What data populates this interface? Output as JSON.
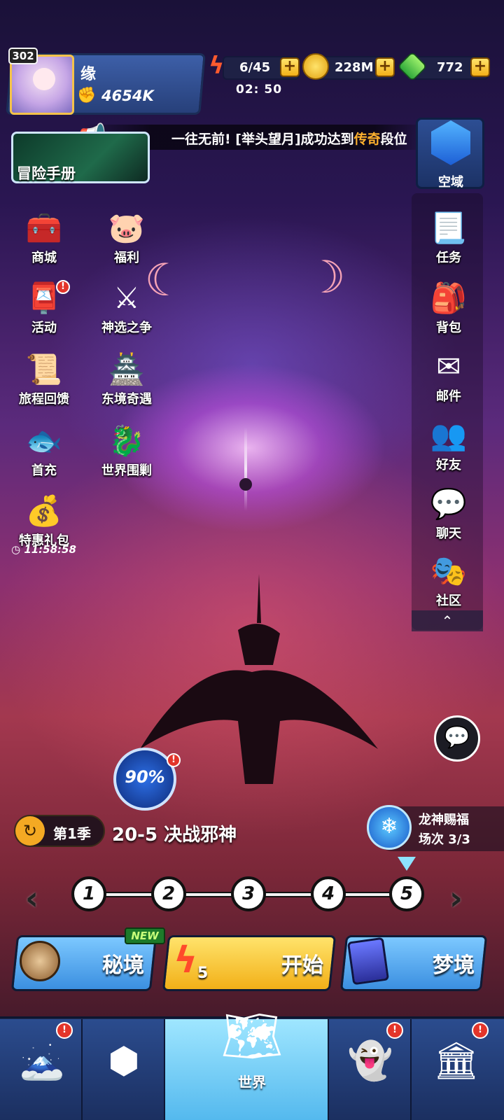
{
  "player": {
    "level": "302",
    "name": "缘",
    "power": "4654K"
  },
  "resources": {
    "energy": "6/45",
    "energy_timer": "02: 50",
    "gold": "228M",
    "gems": "772"
  },
  "marquee": {
    "text_prefix": "一往无前! [举头望月]成功达到",
    "text_highlight": "传奇",
    "text_suffix": "段位"
  },
  "adventure_manual": "冒险手册",
  "zone": "空域",
  "left_menu": [
    {
      "label": "商城",
      "icon": "chest-icon",
      "alert": false
    },
    {
      "label": "福利",
      "icon": "piggy-icon",
      "alert": false
    },
    {
      "label": "活动",
      "icon": "mailbox-icon",
      "alert": true
    },
    {
      "label": "神选之争",
      "icon": "crossed-swords-icon",
      "alert": false
    },
    {
      "label": "旅程回馈",
      "icon": "scroll-icon",
      "alert": false
    },
    {
      "label": "东境奇遇",
      "icon": "pagoda-icon",
      "alert": false
    },
    {
      "label": "首充",
      "icon": "gift-fish-icon",
      "alert": false
    },
    {
      "label": "世界围剿",
      "icon": "dragon-head-icon",
      "alert": false
    },
    {
      "label": "特惠礼包",
      "icon": "gold-bag-icon",
      "alert": false
    }
  ],
  "special_pack_timer": "11:58:58",
  "right_menu": [
    {
      "label": "任务",
      "icon": "quest-scroll-icon"
    },
    {
      "label": "背包",
      "icon": "backpack-icon"
    },
    {
      "label": "邮件",
      "icon": "mail-icon"
    },
    {
      "label": "好友",
      "icon": "friends-icon"
    },
    {
      "label": "聊天",
      "icon": "chat-icon"
    },
    {
      "label": "社区",
      "icon": "community-icon"
    }
  ],
  "progress_percent": "90%",
  "season": {
    "label": "第1季",
    "stage": "20-5 决战邪神"
  },
  "dragon_blessing": {
    "title": "龙神赐福",
    "count": "场次 3/3"
  },
  "stages": [
    "1",
    "2",
    "3",
    "4",
    "5"
  ],
  "modes": {
    "secret": "秘境",
    "new_tag": "NEW",
    "start": "开始",
    "start_cost": "5",
    "dream": "梦境"
  },
  "bottom_nav": {
    "active_label": "世界"
  },
  "colors": {
    "accent_gold": "#f2b018",
    "highlight_orange": "#ffb22e",
    "alert_red": "#e3352a",
    "mode_blue": "#4fa8f0",
    "start_yellow": "#f6c83a"
  }
}
